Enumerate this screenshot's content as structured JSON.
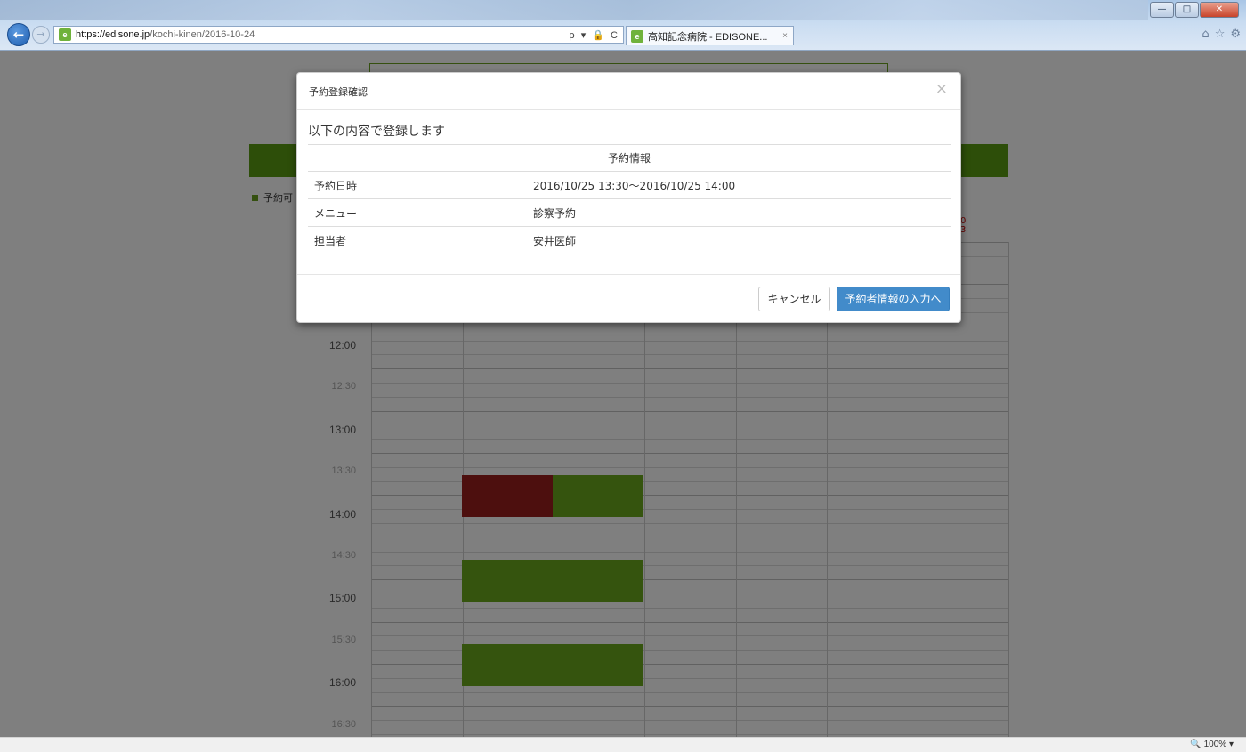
{
  "browser": {
    "url_host": "https://edisone.jp",
    "url_path": "/kochi-kinen/2016-10-24",
    "address_tools": "ρ ▾ 🔒 C",
    "tab_title": "高知記念病院 - EDISONE...",
    "tab_close": "×",
    "window_controls": [
      "—",
      "□",
      "✕"
    ],
    "zoom": "100%"
  },
  "page": {
    "legend_text": "予約可",
    "day_mark_line1": "0",
    "day_mark_line2": "3",
    "times": [
      {
        "label": "12:00",
        "half": false
      },
      {
        "label": "12:30",
        "half": true
      },
      {
        "label": "13:00",
        "half": false
      },
      {
        "label": "13:30",
        "half": true
      },
      {
        "label": "14:00",
        "half": false
      },
      {
        "label": "14:30",
        "half": true
      },
      {
        "label": "15:00",
        "half": false
      },
      {
        "label": "15:30",
        "half": true
      },
      {
        "label": "16:00",
        "half": false
      },
      {
        "label": "16:30",
        "half": true
      }
    ],
    "colors": {
      "available": "#6ba81d",
      "selected": "#9b1f1c",
      "header": "#5b9c12"
    }
  },
  "modal": {
    "title": "予約登録確認",
    "close": "×",
    "lead": "以下の内容で登録します",
    "table_header": "予約情報",
    "rows": [
      {
        "key": "予約日時",
        "value": "2016/10/25 13:30～2016/10/25 14:00"
      },
      {
        "key": "メニュー",
        "value": "診察予約"
      },
      {
        "key": "担当者",
        "value": "安井医師"
      }
    ],
    "cancel_label": "キャンセル",
    "submit_label": "予約者情報の入力へ",
    "primary_color": "#428bca"
  }
}
